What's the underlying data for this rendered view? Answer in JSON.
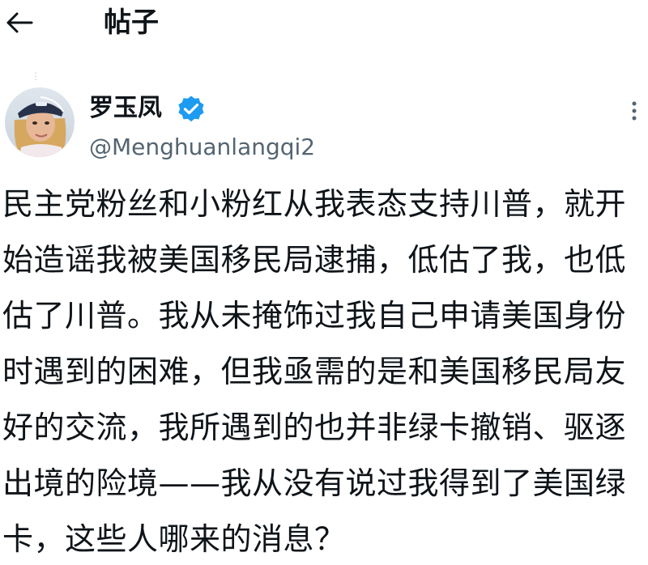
{
  "header": {
    "back_icon": "arrow-left-icon",
    "title": "帖子"
  },
  "post": {
    "author": {
      "name": "罗玉凤",
      "handle": "@Menghuanlangqi2",
      "verified": true,
      "verified_icon": "verified-badge-icon",
      "avatar_icon": "avatar"
    },
    "more_icon": "more-vertical-icon",
    "lines": [
      "民主党粉丝和小粉红从我表态支持川普，就开",
      "始造谣我被美国移民局逮捕，低估了我，也低",
      "估了川普。我从未掩饰过我自己申请美国身份",
      "时遇到的困难，但我亟需的是和美国移民局友",
      "好的交流，我所遇到的也并非绿卡撤销、驱逐",
      "出境的险境——我从没有说过我得到了美国绿",
      "卡，这些人哪来的消息？"
    ]
  },
  "colors": {
    "text": "#0f1419",
    "handle": "#536471",
    "verified": "#1d9bf0"
  }
}
